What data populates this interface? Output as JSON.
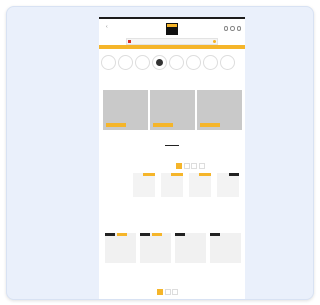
{
  "header": {
    "back_label": "‹",
    "logo_text": "",
    "icons": [
      "search-icon",
      "account-icon",
      "cart-icon"
    ]
  },
  "search": {
    "placeholder": ""
  },
  "promo_bar": {
    "text": ""
  },
  "categories": [
    "",
    "",
    "",
    "",
    "",
    "",
    "",
    ""
  ],
  "banners": [
    {
      "title": "",
      "button": ""
    },
    {
      "title": "",
      "button": ""
    },
    {
      "title": "",
      "button": ""
    }
  ],
  "section1": {
    "title": "",
    "tabs": [
      "",
      "",
      "",
      ""
    ],
    "products": [
      {
        "price": "",
        "name": ""
      },
      {
        "price": "",
        "name": ""
      },
      {
        "price": "",
        "name": ""
      },
      {
        "price": "",
        "name": ""
      }
    ]
  },
  "section2": {
    "title": "",
    "see_all": "",
    "products": [
      {
        "price": "",
        "name": ""
      },
      {
        "price": "",
        "name": ""
      },
      {
        "price": "",
        "name": ""
      },
      {
        "price": "",
        "name": ""
      }
    ]
  },
  "section3": {
    "title": "",
    "tabs": [
      "",
      "",
      ""
    ]
  },
  "colors": {
    "accent": "#f5b52a",
    "dark": "#1c1c1c"
  }
}
